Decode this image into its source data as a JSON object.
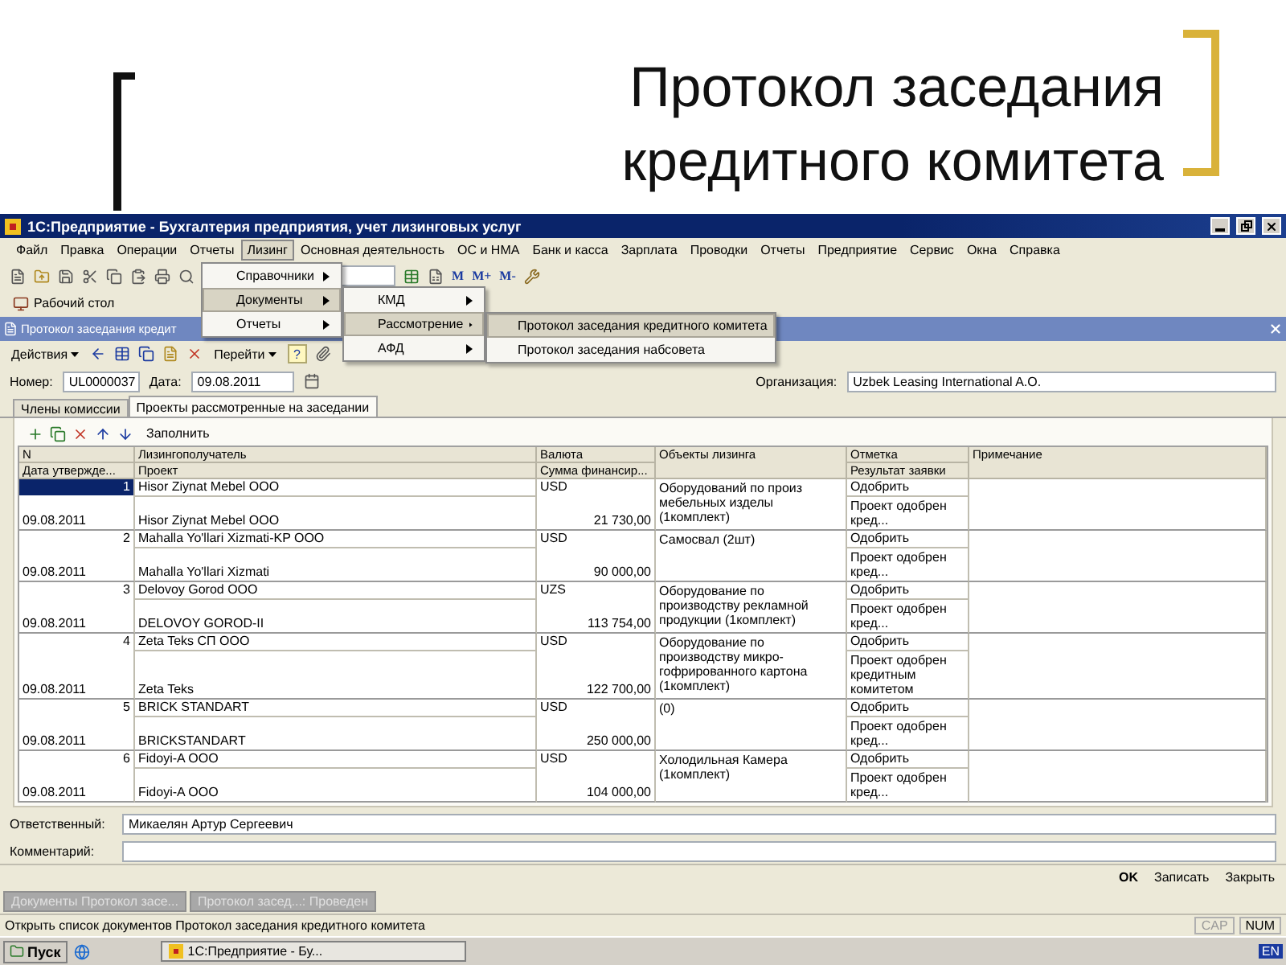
{
  "slide": {
    "title_lines": [
      "Протокол заседания",
      "кредитного комитета"
    ]
  },
  "window": {
    "title": "1С:Предприятие - Бухгалтерия предприятия, учет лизинговых услуг"
  },
  "menu": [
    {
      "label": "Файл",
      "selected": false
    },
    {
      "label": "Правка",
      "selected": false
    },
    {
      "label": "Операции",
      "selected": false
    },
    {
      "label": "Отчеты",
      "selected": false
    },
    {
      "label": "Лизинг",
      "selected": true
    },
    {
      "label": "Основная деятельность",
      "selected": false
    },
    {
      "label": "ОС и НМА",
      "selected": false
    },
    {
      "label": "Банк и касса",
      "selected": false
    },
    {
      "label": "Зарплата",
      "selected": false
    },
    {
      "label": "Проводки",
      "selected": false
    },
    {
      "label": "Отчеты",
      "selected": false
    },
    {
      "label": "Предприятие",
      "selected": false
    },
    {
      "label": "Сервис",
      "selected": false
    },
    {
      "label": "Окна",
      "selected": false
    },
    {
      "label": "Справка",
      "selected": false
    }
  ],
  "leasing_menu": [
    {
      "label": "Справочники",
      "selected": false
    },
    {
      "label": "Документы",
      "selected": true
    },
    {
      "label": "Отчеты",
      "selected": false
    }
  ],
  "documents_menu": [
    {
      "label": "КМД",
      "selected": false
    },
    {
      "label": "Рассмотрение",
      "selected": true
    },
    {
      "label": "АФД",
      "selected": false
    }
  ],
  "review_menu": [
    {
      "label": "Протокол заседания кредитного комитета",
      "selected": true
    },
    {
      "label": "Протокол заседания набсовета",
      "selected": false
    }
  ],
  "toolbar": {
    "memory_buttons": [
      "M",
      "M+",
      "M-"
    ],
    "desktop": "Рабочий стол"
  },
  "document": {
    "title": "Протокол заседания кредит",
    "actions": "Действия",
    "goto": "Перейти",
    "help": "?",
    "fields": {
      "number_label": "Номер:",
      "number": "UL0000037",
      "date_label": "Дата:",
      "date": "09.08.2011",
      "org_label": "Организация:",
      "org": "Uzbek Leasing International A.O."
    },
    "tabs": [
      {
        "label": "Члены комиссии",
        "selected": false
      },
      {
        "label": "Проекты рассмотренные на заседании",
        "selected": true
      }
    ],
    "fill": "Заполнить",
    "columns": [
      {
        "top": "N",
        "bottom": "Дата утвержде..."
      },
      {
        "top": "Лизингополучатель",
        "bottom": "Проект"
      },
      {
        "top": "Валюта",
        "bottom": "Сумма финансир..."
      },
      {
        "top": "Объекты лизинга"
      },
      {
        "top": "Отметка",
        "bottom": "Результат заявки"
      },
      {
        "top": "Примечание"
      }
    ],
    "rows": [
      {
        "n": "1",
        "date": "09.08.2011",
        "lessee": "Hisor Ziynat Mebel OOO",
        "project": "Hisor Ziynat Mebel OOO",
        "currency": "USD",
        "amount": "21 730,00",
        "objects": "Оборудований по произ мебельных изделы (1комплект)",
        "mark": "Одобрить",
        "result": "Проект одобрен кред...",
        "selected": true
      },
      {
        "n": "2",
        "date": "09.08.2011",
        "lessee": "Mahalla Yo'llari Xizmati-KP OOO",
        "project": "Mahalla Yo'llari Xizmati",
        "currency": "USD",
        "amount": "90 000,00",
        "objects": "Самосвал (2шт)",
        "mark": "Одобрить",
        "result": "Проект одобрен кред...",
        "selected": false
      },
      {
        "n": "3",
        "date": "09.08.2011",
        "lessee": "Delovoy Gorod OOO",
        "project": "DELOVOY GOROD-II",
        "currency": "UZS",
        "amount": "113 754,00",
        "objects": "Оборудование по производству рекламной продукции (1комплект)",
        "mark": "Одобрить",
        "result": "Проект одобрен кред...",
        "selected": false
      },
      {
        "n": "4",
        "date": "09.08.2011",
        "lessee": "Zeta Teks СП OOO",
        "project": "Zeta Teks",
        "currency": "USD",
        "amount": "122 700,00",
        "objects": "Оборудование по производству микро-гофрированного картона (1комплект)",
        "mark": "Одобрить",
        "result": "Проект одобрен кредитным комитетом",
        "selected": false
      },
      {
        "n": "5",
        "date": "09.08.2011",
        "lessee": "BRICK STANDART",
        "project": "BRICKSTANDART",
        "currency": "USD",
        "amount": "250 000,00",
        "objects": "(0)",
        "mark": "Одобрить",
        "result": "Проект одобрен кред...",
        "selected": false
      },
      {
        "n": "6",
        "date": "09.08.2011",
        "lessee": "Fidoyi-A OOO",
        "project": "Fidoyi-A OOO",
        "currency": "USD",
        "amount": "104 000,00",
        "objects": "Холодильная Камера (1комплект)",
        "mark": "Одобрить",
        "result": "Проект одобрен кред...",
        "selected": false
      }
    ],
    "responsible_label": "Ответственный:",
    "responsible": "Микаелян Артур Сергеевич",
    "comment_label": "Комментарий:",
    "buttons": [
      "OK",
      "Записать",
      "Закрыть"
    ]
  },
  "window_tabs": [
    "Документы Протокол засе...",
    "Протокол засед...: Проведен"
  ],
  "status": {
    "text": "Открыть список документов Протокол заседания кредитного комитета",
    "indicators": [
      "CAP",
      "NUM"
    ]
  },
  "taskbar": {
    "start": "Пуск",
    "task": "1С:Предприятие - Бу...",
    "lang": "EN"
  }
}
